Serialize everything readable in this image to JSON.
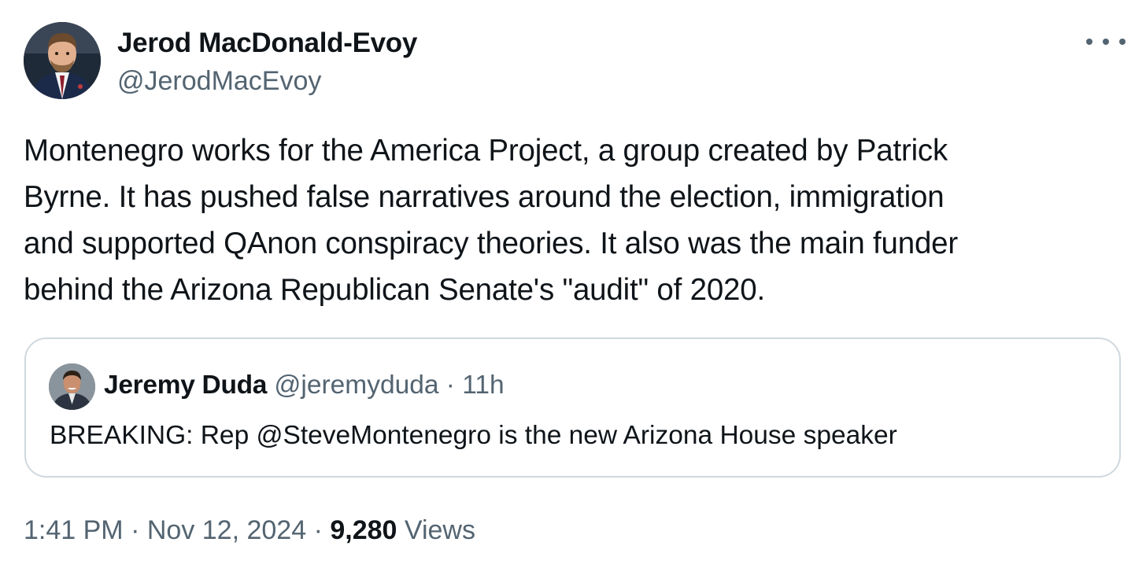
{
  "author": {
    "name": "Jerod MacDonald-Evoy",
    "handle": "@JerodMacEvoy",
    "avatar_icon": "profile-photo-man-red-tie"
  },
  "tweet": {
    "text": "Montenegro works for the America Project, a group created by Patrick\nByrne. It has pushed false narratives around the election, immigration\nand supported QAnon conspiracy theories. It also was the main funder\nbehind the Arizona Republican Senate's \"audit\" of 2020."
  },
  "quote": {
    "name": "Jeremy Duda",
    "handle": "@jeremyduda",
    "separator": "·",
    "time": "11h",
    "text": "BREAKING: Rep @SteveMontenegro is the new Arizona House speaker",
    "avatar_icon": "profile-photo-man-smiling"
  },
  "meta": {
    "time": "1:41 PM",
    "separator": "·",
    "date": "Nov 12, 2024",
    "views_count": "9,280",
    "views_label": "Views"
  },
  "more_menu_icon": "more-horizontal-icon",
  "colors": {
    "text_primary": "#0f1419",
    "text_secondary": "#536471",
    "border": "#cfd9de",
    "background": "#ffffff"
  }
}
